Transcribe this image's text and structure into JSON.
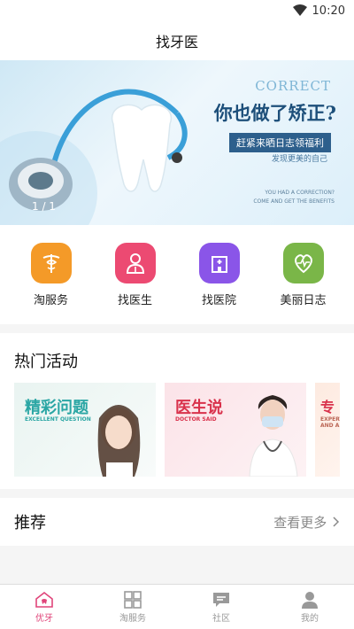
{
  "status": {
    "time": "10:20"
  },
  "header": {
    "title": "找牙医"
  },
  "banner": {
    "correct": "CORRECT",
    "headline": "你也做了矫正?",
    "pill": "赶紧来晒日志领福利",
    "sub": "发现更美的自己",
    "en_line1": "YOU HAD A CORRECTION?",
    "en_line2": "COME AND GET THE BENEFITS",
    "indicator": "1 / 1"
  },
  "quick": [
    {
      "label": "淘服务",
      "icon": "caduceus-icon",
      "color": "#f49a28"
    },
    {
      "label": "找医生",
      "icon": "doctor-icon",
      "color": "#ec4a72"
    },
    {
      "label": "找医院",
      "icon": "hospital-icon",
      "color": "#8a55e8"
    },
    {
      "label": "美丽日志",
      "icon": "heart-pulse-icon",
      "color": "#7ab648"
    }
  ],
  "hot": {
    "title": "热门活动",
    "cards": [
      {
        "title": "精彩问题",
        "subtitle": "EXCELLENT QUESTION"
      },
      {
        "title": "医生说",
        "subtitle": "DOCTOR SAID"
      },
      {
        "title": "专",
        "subtitle": "EXPERT AND A"
      }
    ]
  },
  "recommend": {
    "title": "推荐",
    "more": "查看更多"
  },
  "tabs": [
    {
      "label": "优牙",
      "icon": "home-tooth-icon",
      "active": true
    },
    {
      "label": "淘服务",
      "icon": "grid-icon",
      "active": false
    },
    {
      "label": "社区",
      "icon": "chat-icon",
      "active": false
    },
    {
      "label": "我的",
      "icon": "user-icon",
      "active": false
    }
  ],
  "colors": {
    "accent": "#e0457a",
    "inactive": "#999999"
  }
}
